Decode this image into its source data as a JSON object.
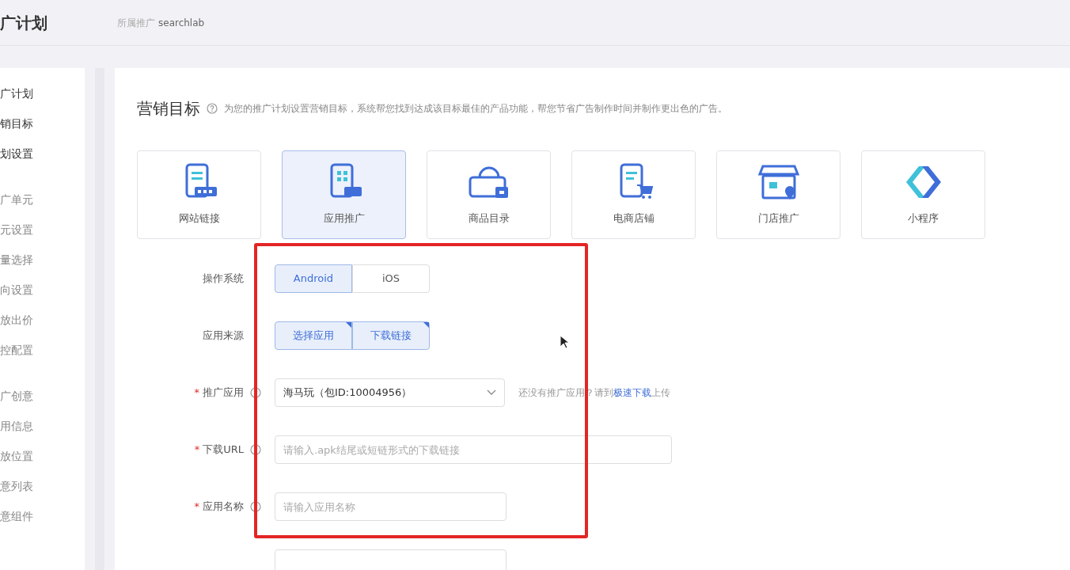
{
  "header": {
    "title": "广计划",
    "breadcrumb_label": "所属推广",
    "breadcrumb_value": "searchlab"
  },
  "sidebar": {
    "groups": [
      {
        "title": "广计划",
        "active": true,
        "items": [
          "销目标",
          "划设置"
        ]
      },
      {
        "title": "广单元",
        "active": false,
        "items": [
          "元设置",
          "量选择",
          "向设置",
          "放出价",
          "控配置"
        ]
      },
      {
        "title": "广创意",
        "active": false,
        "items": [
          "用信息",
          "放位置",
          "意列表",
          "意组件"
        ]
      }
    ]
  },
  "section": {
    "title": "营销目标",
    "description": "为您的推广计划设置营销目标，系统帮您找到达成该目标最佳的产品功能，帮您节省广告制作时间并制作更出色的广告。"
  },
  "goals": [
    {
      "label": "网站链接",
      "selected": false
    },
    {
      "label": "应用推广",
      "selected": true
    },
    {
      "label": "商品目录",
      "selected": false
    },
    {
      "label": "电商店铺",
      "selected": false
    },
    {
      "label": "门店推广",
      "selected": false
    },
    {
      "label": "小程序",
      "selected": false
    }
  ],
  "form": [
    {
      "kind": "segmented",
      "label": "操作系统",
      "help": false,
      "options": [
        {
          "label": "Android",
          "selected": true
        },
        {
          "label": "iOS",
          "selected": false
        }
      ]
    },
    {
      "kind": "segmented",
      "label": "应用来源",
      "help": false,
      "options": [
        {
          "label": "选择应用",
          "selected": true
        },
        {
          "label": "下载链接",
          "selected": true
        }
      ]
    },
    {
      "kind": "select",
      "label": "推广应用",
      "required_mark": "*",
      "help": true,
      "value": "海马玩（包ID:10004956）",
      "hint": "还没有推广应用？请到",
      "hint_link": "极速下载",
      "hint_tail": "上传"
    },
    {
      "kind": "input",
      "label": "下载URL",
      "required_mark": "*",
      "help": true,
      "placeholder": "请输入.apk结尾或短链形式的下载链接",
      "wide": true
    },
    {
      "kind": "input",
      "label": "应用名称",
      "required_mark": "*",
      "help": true,
      "placeholder": "请输入应用名称",
      "wide": false
    }
  ]
}
